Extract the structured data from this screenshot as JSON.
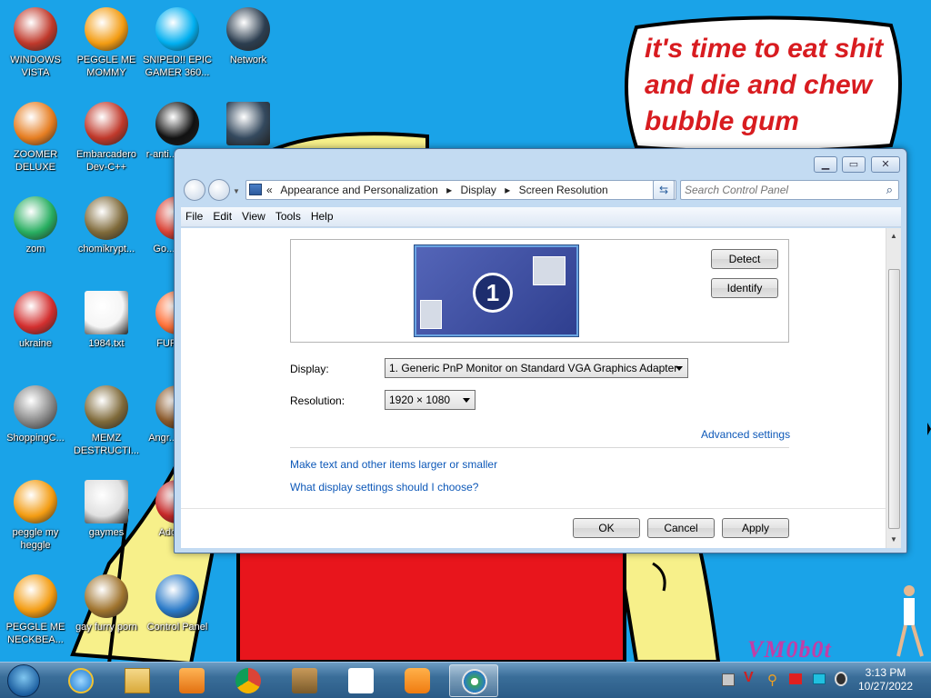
{
  "desktop": {
    "icons": [
      {
        "label": "WINDOWS VISTA",
        "icon": "vista-logo-icon"
      },
      {
        "label": "PEGGLE ME MOMMY",
        "icon": "peggle-icon"
      },
      {
        "label": "SNIPED!! EPIC GAMER 360...",
        "icon": "skype-icon"
      },
      {
        "label": "Network",
        "icon": "network-globe-icon"
      },
      {
        "label": "ZOOMER DELUXE",
        "icon": "zoomer-icon"
      },
      {
        "label": "Embarcadero Dev-C++",
        "icon": "devcpp-icon"
      },
      {
        "label": "r-anti... para...",
        "icon": "program-icon"
      },
      {
        "label": "",
        "icon": "laptop-icon"
      },
      {
        "label": "zom",
        "icon": "flower-icon"
      },
      {
        "label": "chomikrypt...",
        "icon": "chomik-icon"
      },
      {
        "label": "Go... Chr...",
        "icon": "chrome-icon"
      },
      {
        "label": "ukraine",
        "icon": "radiation-icon"
      },
      {
        "label": "1984.txt",
        "icon": "text-file-icon"
      },
      {
        "label": "FURRY...",
        "icon": "firefox-icon"
      },
      {
        "label": "ShoppingC...",
        "icon": "flash-icon"
      },
      {
        "label": "MEMZ DESTRUCTI...",
        "icon": "memz-icon"
      },
      {
        "label": "Angr... Sea...",
        "icon": "angry-birds-icon"
      },
      {
        "label": "peggle my heggle",
        "icon": "peggle-icon"
      },
      {
        "label": "gaymes",
        "icon": "games-folder-icon"
      },
      {
        "label": "Adobe...",
        "icon": "adobe-icon"
      },
      {
        "label": "PEGGLE ME NECKBEA...",
        "icon": "peggle-icon"
      },
      {
        "label": "gay furry porn",
        "icon": "bonzi-box-icon"
      },
      {
        "label": "Control Panel",
        "icon": "control-panel-icon"
      }
    ]
  },
  "speech_bubble": {
    "text": "it's time to eat shit and die and chew bubble gum"
  },
  "watermark": {
    "text": "VM0b0t"
  },
  "window": {
    "breadcrumb": {
      "overflow": "«",
      "items": [
        "Appearance and Personalization",
        "Display",
        "Screen Resolution"
      ]
    },
    "search": {
      "placeholder": "Search Control Panel"
    },
    "menu": [
      "File",
      "Edit",
      "View",
      "Tools",
      "Help"
    ],
    "monitor_number": "1",
    "buttons": {
      "detect": "Detect",
      "identify": "Identify",
      "ok": "OK",
      "cancel": "Cancel",
      "apply": "Apply"
    },
    "display_label": "Display:",
    "display_value": "1. Generic PnP Monitor on Standard VGA Graphics Adapter",
    "resolution_label": "Resolution:",
    "resolution_value": "1920 × 1080",
    "advanced_link": "Advanced settings",
    "links": [
      "Make text and other items larger or smaller",
      "What display settings should I choose?"
    ]
  },
  "taskbar": {
    "pinned": [
      "start-orb-icon",
      "internet-explorer-icon",
      "file-explorer-icon",
      "media-player-icon",
      "chrome-icon",
      "bonzi-box-icon",
      "java-icon",
      "uc-browser-icon",
      "control-panel-icon"
    ],
    "tray_icons": [
      "network-tray-icon",
      "v-tray-icon",
      "key-tray-icon",
      "flag-tray-icon",
      "display-tray-icon",
      "volume-tray-icon"
    ],
    "clock": {
      "time": "3:13 PM",
      "date": "10/27/2022"
    }
  },
  "colors": {
    "desktop_bg": "#1aa3e8",
    "bubble_text": "#d81c20",
    "link": "#0d58b8",
    "monitor_blue": "#3a4fa0"
  }
}
